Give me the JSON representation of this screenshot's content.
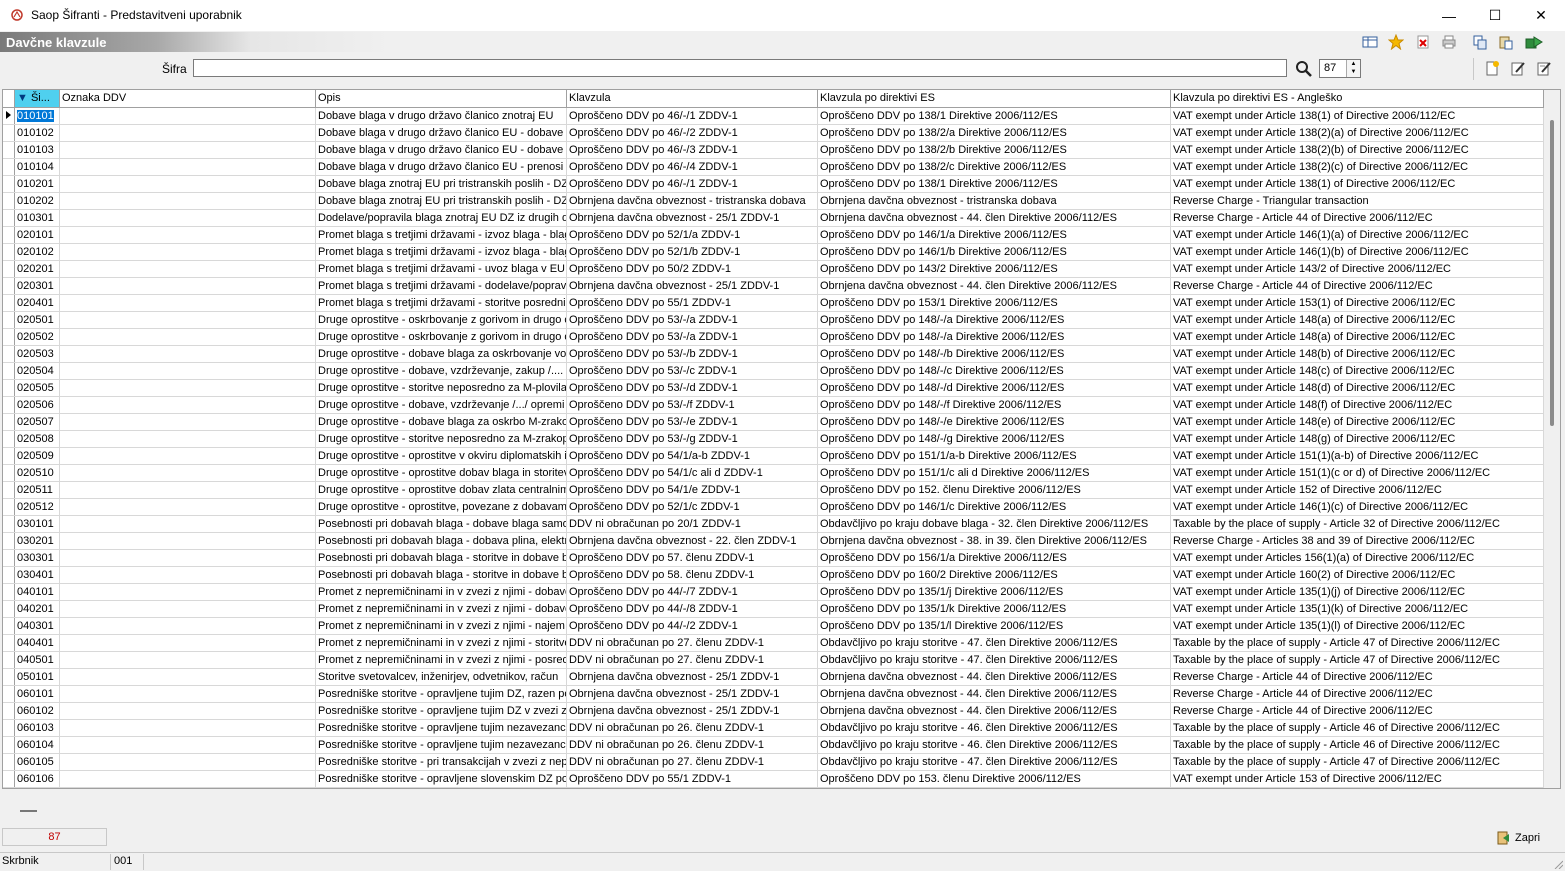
{
  "window": {
    "title": "Saop Šifranti - Predstavitveni uporabnik",
    "minimize": "—",
    "maximize": "☐",
    "close": "✕"
  },
  "form": {
    "title": "Davčne klavzule"
  },
  "filter": {
    "label": "Šifra",
    "value": "",
    "count": "87"
  },
  "grid": {
    "columns": [
      "Ši...",
      "Oznaka DDV",
      "Opis",
      "Klavzula",
      "Klavzula po direktivi ES",
      "Klavzula po direktivi ES - Angleško"
    ],
    "rows": [
      [
        "010101",
        "",
        "Dobave blaga v drugo državo članico znotraj EU",
        "Oproščeno DDV po 46/-/1 ZDDV-1",
        "Oproščeno DDV po 138/1 Direktive 2006/112/ES",
        "VAT exempt under Article 138(1) of Directive 2006/112/EC"
      ],
      [
        "010102",
        "",
        "Dobave blaga v drugo državo članico EU - dobave n",
        "Oproščeno DDV po 46/-/2 ZDDV-1",
        "Oproščeno DDV po 138/2/a Direktive 2006/112/ES",
        "VAT exempt under Article 138(2)(a) of Directive 2006/112/EC"
      ],
      [
        "010103",
        "",
        "Dobave blaga v drugo državo članico EU - dobave tr",
        "Oproščeno DDV po 46/-/3 ZDDV-1",
        "Oproščeno DDV po 138/2/b Direktive 2006/112/ES",
        "VAT exempt under Article 138(2)(b) of Directive 2006/112/EC"
      ],
      [
        "010104",
        "",
        "Dobave blaga v drugo državo članico EU - prenosi bl",
        "Oproščeno DDV po 46/-/4 ZDDV-1",
        "Oproščeno DDV po 138/2/c Direktive 2006/112/ES",
        "VAT exempt under Article 138(2)(c) of Directive 2006/112/EC"
      ],
      [
        "010201",
        "",
        "Dobave blaga znotraj EU pri tristranskih poslih - DZ s",
        "Oproščeno DDV po 46/-/1 ZDDV-1",
        "Oproščeno DDV po 138/1 Direktive 2006/112/ES",
        "VAT exempt under Article 138(1) of Directive 2006/112/EC"
      ],
      [
        "010202",
        "",
        "Dobave blaga znotraj EU pri tristranskih poslih - DZ s",
        "Obrnjena davčna obveznost - tristranska dobava",
        "Obrnjena davčna obveznost - tristranska dobava",
        "Reverse Charge - Triangular transaction"
      ],
      [
        "010301",
        "",
        "Dodelave/popravila blaga znotraj EU DZ iz drugih dr",
        "Obrnjena davčna obveznost - 25/1 ZDDV-1",
        "Obrnjena davčna obveznost - 44. člen Direktive 2006/112/ES",
        "Reverse Charge - Article 44 of Directive 2006/112/EC"
      ],
      [
        "020101",
        "",
        "Promet blaga s tretjimi državami - izvoz blaga - blago",
        "Oproščeno DDV po 52/1/a ZDDV-1",
        "Oproščeno DDV po 146/1/a Direktive 2006/112/ES",
        "VAT exempt under Article 146(1)(a) of Directive 2006/112/EC"
      ],
      [
        "020102",
        "",
        "Promet blaga s tretjimi državami - izvoz blaga - blago",
        "Oproščeno DDV po 52/1/b ZDDV-1",
        "Oproščeno DDV po 146/1/b Direktive 2006/112/ES",
        "VAT exempt under Article 146(1)(b) of Directive 2006/112/EC"
      ],
      [
        "020201",
        "",
        "Promet blaga s tretjimi državami - uvoz blaga v EU, o",
        "Oproščeno DDV po 50/2 ZDDV-1",
        "Oproščeno DDV po 143/2 Direktive 2006/112/ES",
        "VAT exempt under Article 143/2 of Directive 2006/112/EC"
      ],
      [
        "020301",
        "",
        "Promet blaga s tretjimi državami - dodelave/popravil",
        "Obrnjena davčna obveznost - 25/1 ZDDV-1",
        "Obrnjena davčna obveznost - 44. člen Direktive 2006/112/ES",
        "Reverse Charge - Article 44 of Directive 2006/112/EC"
      ],
      [
        "020401",
        "",
        "Promet blaga s tretjimi državami - storitve posredni",
        "Oproščeno DDV po 55/1 ZDDV-1",
        "Oproščeno DDV po 153/1 Direktive 2006/112/ES",
        "VAT exempt under Article 153(1) of Directive 2006/112/EC"
      ],
      [
        "020501",
        "",
        "Druge oprostitve - oskrbovanje z gorivom in drugo o",
        "Oproščeno DDV po 53/-/a ZDDV-1",
        "Oproščeno DDV po 148/-/a Direktive 2006/112/ES",
        "VAT exempt under Article 148(a) of Directive 2006/112/EC"
      ],
      [
        "020502",
        "",
        "Druge oprostitve - oskrbovanje z gorivom in drugo o",
        "Oproščeno DDV po 53/-/a ZDDV-1",
        "Oproščeno DDV po 148/-/a Direktive 2006/112/ES",
        "VAT exempt under Article 148(a) of Directive 2006/112/EC"
      ],
      [
        "020503",
        "",
        "Druge oprostitve - dobave blaga za oskrbovanje vo",
        "Oproščeno DDV po 53/-/b ZDDV-1",
        "Oproščeno DDV po 148/-/b Direktive 2006/112/ES",
        "VAT exempt under Article 148(b) of Directive 2006/112/EC"
      ],
      [
        "020504",
        "",
        "Druge oprostitve - dobave, vzdrževanje, zakup /....",
        "Oproščeno DDV po 53/-/c ZDDV-1",
        "Oproščeno DDV po 148/-/c Direktive 2006/112/ES",
        "VAT exempt under Article 148(c) of Directive 2006/112/EC"
      ],
      [
        "020505",
        "",
        "Druge oprostitve - storitve neposredno za M-plovila",
        "Oproščeno DDV po 53/-/d ZDDV-1",
        "Oproščeno DDV po 148/-/d Direktive 2006/112/ES",
        "VAT exempt under Article 148(d) of Directive 2006/112/EC"
      ],
      [
        "020506",
        "",
        "Druge oprostitve - dobave, vzdrževanje /.../ opremi",
        "Oproščeno DDV po 53/-/f ZDDV-1",
        "Oproščeno DDV po 148/-/f Direktive 2006/112/ES",
        "VAT exempt under Article 148(f) of Directive 2006/112/EC"
      ],
      [
        "020507",
        "",
        "Druge oprostitve - dobave blaga za oskrbo M-zrakop",
        "Oproščeno DDV po 53/-/e ZDDV-1",
        "Oproščeno DDV po 148/-/e Direktive 2006/112/ES",
        "VAT exempt under Article 148(e) of Directive 2006/112/EC"
      ],
      [
        "020508",
        "",
        "Druge oprostitve - storitve neposredno za M-zrakop",
        "Oproščeno DDV po 53/-/g ZDDV-1",
        "Oproščeno DDV po 148/-/g Direktive 2006/112/ES",
        "VAT exempt under Article 148(g) of Directive 2006/112/EC"
      ],
      [
        "020509",
        "",
        "Druge oprostitve - oprostitve v okviru diplomatskih i",
        "Oproščeno DDV po 54/1/a-b ZDDV-1",
        "Oproščeno DDV po 151/1/a-b Direktive 2006/112/ES",
        "VAT exempt under Article 151(1)(a-b) of Directive 2006/112/EC"
      ],
      [
        "020510",
        "",
        "Druge oprostitve - oprostitve dobav blaga in storitev",
        "Oproščeno DDV po 54/1/c ali d ZDDV-1",
        "Oproščeno DDV po 151/1/c ali d Direktive 2006/112/ES",
        "VAT exempt under Article 151(1)(c or d) of Directive 2006/112/EC"
      ],
      [
        "020511",
        "",
        "Druge oprostitve - oprostitve dobav zlata centralnim",
        "Oproščeno DDV po 54/1/e ZDDV-1",
        "Oproščeno DDV po 152. členu Direktive 2006/112/ES",
        "VAT exempt under Article 152 of Directive 2006/112/EC"
      ],
      [
        "020512",
        "",
        "Druge oprostitve - oprostitve, povezane z dobavam",
        "Oproščeno DDV po 52/1/c ZDDV-1",
        "Oproščeno DDV po 146/1/c Direktive 2006/112/ES",
        "VAT exempt under Article 146(1)(c) of Directive 2006/112/EC"
      ],
      [
        "030101",
        "",
        "Posebnosti pri dobavah blaga - dobave blaga samo p",
        "DDV ni obračunan po 20/1 ZDDV-1",
        "Obdavčljivo po kraju dobave blaga - 32. člen Direktive 2006/112/ES",
        "Taxable by the place of supply - Article 32 of Directive 2006/112/EC"
      ],
      [
        "030201",
        "",
        "Posebnosti pri dobavah blaga - dobava plina, elektri",
        "Obrnjena davčna obveznost - 22. člen ZDDV-1",
        "Obrnjena davčna obveznost - 38. in 39. člen Direktive 2006/112/ES",
        "Reverse Charge - Articles 38 and 39 of Directive 2006/112/EC"
      ],
      [
        "030301",
        "",
        "Posebnosti pri dobavah blaga - storitve in dobave bl",
        "Oproščeno DDV po 57. členu ZDDV-1",
        "Oproščeno DDV po 156/1/a Direktive 2006/112/ES",
        "VAT exempt under Articles 156(1)(a) of Directive 2006/112/EC"
      ],
      [
        "030401",
        "",
        "Posebnosti pri dobavah blaga - storitve in dobave bl",
        "Oproščeno DDV po 58. členu ZDDV-1",
        "Oproščeno DDV po 160/2 Direktive 2006/112/ES",
        "VAT exempt under Article 160(2) of Directive 2006/112/EC"
      ],
      [
        "040101",
        "",
        "Promet z nepremičninami in v zvezi z njimi - dobave s",
        "Oproščeno DDV po 44/-/7 ZDDV-1",
        "Oproščeno DDV po 135/1/j Direktive 2006/112/ES",
        "VAT exempt under Article 135(1)(j) of Directive 2006/112/EC"
      ],
      [
        "040201",
        "",
        "Promet z nepremičninami in v zvezi z njimi - dobave z",
        "Oproščeno DDV po 44/-/8 ZDDV-1",
        "Oproščeno DDV po 135/1/k Direktive 2006/112/ES",
        "VAT exempt under Article 135(1)(k) of Directive 2006/112/EC"
      ],
      [
        "040301",
        "",
        "Promet z nepremičninami in v zvezi z njimi - najem ne",
        "Oproščeno DDV po 44/-/2 ZDDV-1",
        "Oproščeno DDV po 135/1/l Direktive 2006/112/ES",
        "VAT exempt under Article 135(1)(l) of Directive 2006/112/EC"
      ],
      [
        "040401",
        "",
        "Promet z nepremičninami in v zvezi z njimi - storitve",
        "DDV ni obračunan po 27. členu ZDDV-1",
        "Obdavčljivo po kraju storitve - 47. člen Direktive 2006/112/ES",
        "Taxable by the place of supply - Article 47 of Directive 2006/112/EC"
      ],
      [
        "040501",
        "",
        "Promet z nepremičninami in v zvezi z njimi - posredo",
        "DDV ni obračunan po 27. členu ZDDV-1",
        "Obdavčljivo po kraju storitve - 47. člen Direktive 2006/112/ES",
        "Taxable by the place of supply - Article 47 of Directive 2006/112/EC"
      ],
      [
        "050101",
        "",
        "Storitve svetovalcev, inženirjev, odvetnikov, račun",
        "Obrnjena davčna obveznost - 25/1 ZDDV-1",
        "Obrnjena davčna obveznost - 44. člen Direktive 2006/112/ES",
        "Reverse Charge - Article 44 of Directive 2006/112/EC"
      ],
      [
        "060101",
        "",
        "Posredniške storitve - opravljene tujim DZ, razen po",
        "Obrnjena davčna obveznost - 25/1 ZDDV-1",
        "Obrnjena davčna obveznost - 44. člen Direktive 2006/112/ES",
        "Reverse Charge - Article 44 of Directive 2006/112/EC"
      ],
      [
        "060102",
        "",
        "Posredniške storitve - opravljene tujim DZ v zvezi z d",
        "Obrnjena davčna obveznost - 25/1 ZDDV-1",
        "Obrnjena davčna obveznost - 44. člen Direktive 2006/112/ES",
        "Reverse Charge - Article 44 of Directive 2006/112/EC"
      ],
      [
        "060103",
        "",
        "Posredniške storitve - opravljene tujim nezavezance",
        "DDV ni obračunan po 26. členu ZDDV-1",
        "Obdavčljivo po kraju storitve - 46. člen Direktive 2006/112/ES",
        "Taxable by the place of supply - Article 46 of Directive 2006/112/EC"
      ],
      [
        "060104",
        "",
        "Posredniške storitve - opravljene tujim nezavezance",
        "DDV ni obračunan po 26. členu ZDDV-1",
        "Obdavčljivo po kraju storitve - 46. člen Direktive 2006/112/ES",
        "Taxable by the place of supply - Article 46 of Directive 2006/112/EC"
      ],
      [
        "060105",
        "",
        "Posredniške storitve - pri transakcijah v zvezi z nepr",
        "DDV ni obračunan po 27. členu ZDDV-1",
        "Obdavčljivo po kraju storitve - 47. člen Direktive 2006/112/ES",
        "Taxable by the place of supply - Article 47 of Directive 2006/112/EC"
      ],
      [
        "060106",
        "",
        "Posredniške storitve - opravljene slovenskim DZ pod",
        "Oproščeno DDV po 55/1 ZDDV-1",
        "Oproščeno DDV po 153. členu Direktive 2006/112/ES",
        "VAT exempt under Article 153 of Directive 2006/112/EC"
      ]
    ]
  },
  "footer": {
    "record_count": "87",
    "close_label": "Zapri"
  },
  "status": {
    "user": "Skrbnik",
    "company": "001"
  },
  "icons": {
    "app": "app-logo-icon",
    "toolbar": [
      "grid-layout-icon",
      "favorite-star-icon",
      "delete-icon",
      "print-icon",
      "copy-icon",
      "paste-icon",
      "export-icon"
    ],
    "actions": [
      "new-record-icon",
      "edit-record-icon",
      "edit-all-icon"
    ],
    "search": "search-icon",
    "close": "close-door-icon"
  },
  "colors": {
    "selection": "#0078d7",
    "sorted_header": "#4fd0ef",
    "count_text": "#c00000"
  }
}
